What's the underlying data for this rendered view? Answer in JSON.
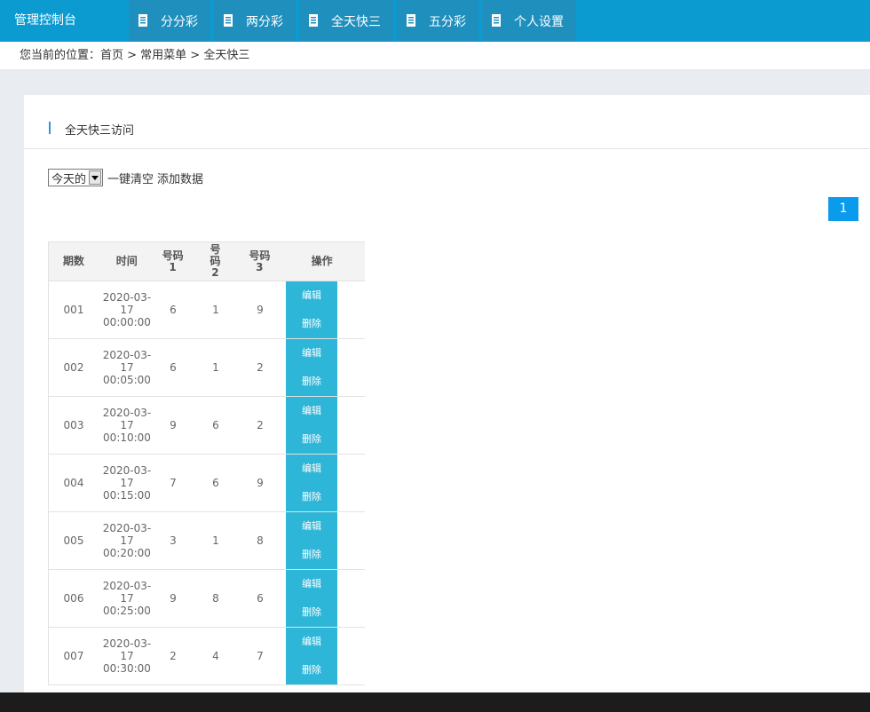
{
  "header": {
    "brand": "管理控制台",
    "nav": [
      {
        "label": "分分彩",
        "icon": "document-icon"
      },
      {
        "label": "两分彩",
        "icon": "document-icon"
      },
      {
        "label": "全天快三",
        "icon": "document-icon"
      },
      {
        "label": "五分彩",
        "icon": "document-icon"
      },
      {
        "label": "个人设置",
        "icon": "document-icon"
      }
    ]
  },
  "breadcrumb": "您当前的位置：首页 > 常用菜单 > 全天快三",
  "panel": {
    "title": "全天快三访问",
    "filter_selected": "今天的",
    "clear_label": "一键清空",
    "add_label": "添加数据",
    "page": "1"
  },
  "table": {
    "headers": [
      "期数",
      "时间",
      "号码1",
      "号码2",
      "号码3",
      "操作"
    ],
    "edit_label": "编辑",
    "delete_label": "删除",
    "rows": [
      {
        "period": "001",
        "time": "2020-03-17 00:00:00",
        "n1": "6",
        "n2": "1",
        "n3": "9"
      },
      {
        "period": "002",
        "time": "2020-03-17 00:05:00",
        "n1": "6",
        "n2": "1",
        "n3": "2"
      },
      {
        "period": "003",
        "time": "2020-03-17 00:10:00",
        "n1": "9",
        "n2": "6",
        "n3": "2"
      },
      {
        "period": "004",
        "time": "2020-03-17 00:15:00",
        "n1": "7",
        "n2": "6",
        "n3": "9"
      },
      {
        "period": "005",
        "time": "2020-03-17 00:20:00",
        "n1": "3",
        "n2": "1",
        "n3": "8"
      },
      {
        "period": "006",
        "time": "2020-03-17 00:25:00",
        "n1": "9",
        "n2": "8",
        "n3": "6"
      },
      {
        "period": "007",
        "time": "2020-03-17 00:30:00",
        "n1": "2",
        "n2": "4",
        "n3": "7"
      }
    ]
  },
  "colors": {
    "topbar": "#0b9bd0",
    "nav_item": "#1f8fbe",
    "action": "#2eb6d8",
    "pager": "#0b9bec"
  }
}
